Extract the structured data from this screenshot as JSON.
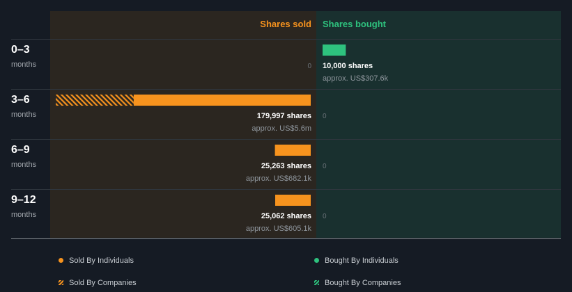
{
  "colors": {
    "sold": "#f7931e",
    "bought": "#2ec27e",
    "sold_bg": "#2b2620",
    "bought_bg": "#19302f",
    "background": "#151b24"
  },
  "chart_data": {
    "type": "bar",
    "title": "",
    "column_headers": {
      "sold": "Shares sold",
      "bought": "Shares bought"
    },
    "rows": [
      {
        "period": "0–3",
        "unit": "months",
        "sold": {
          "individuals": 0,
          "companies": 0,
          "shares_label": "",
          "approx_label": "",
          "zero_label": "0"
        },
        "bought": {
          "individuals": 10000,
          "companies": 0,
          "shares_label": "10,000 shares",
          "approx_label": "approx. US$307.6k",
          "zero_label": ""
        }
      },
      {
        "period": "3–6",
        "unit": "months",
        "sold": {
          "individuals": 125000,
          "companies": 54997,
          "shares_label": "179,997 shares",
          "approx_label": "approx. US$5.6m",
          "zero_label": ""
        },
        "bought": {
          "individuals": 0,
          "companies": 0,
          "shares_label": "",
          "approx_label": "",
          "zero_label": "0"
        }
      },
      {
        "period": "6–9",
        "unit": "months",
        "sold": {
          "individuals": 25263,
          "companies": 0,
          "shares_label": "25,263 shares",
          "approx_label": "approx. US$682.1k",
          "zero_label": ""
        },
        "bought": {
          "individuals": 0,
          "companies": 0,
          "shares_label": "",
          "approx_label": "",
          "zero_label": "0"
        }
      },
      {
        "period": "9–12",
        "unit": "months",
        "sold": {
          "individuals": 25062,
          "companies": 0,
          "shares_label": "25,062 shares",
          "approx_label": "approx. US$605.1k",
          "zero_label": ""
        },
        "bought": {
          "individuals": 0,
          "companies": 0,
          "shares_label": "",
          "approx_label": "",
          "zero_label": "0"
        }
      }
    ],
    "sold_max": 179997,
    "bought_max": 110000,
    "legend": {
      "sold_individuals": "Sold By Individuals",
      "bought_individuals": "Bought By Individuals",
      "sold_companies": "Sold By Companies",
      "bought_companies": "Bought By Companies"
    }
  }
}
